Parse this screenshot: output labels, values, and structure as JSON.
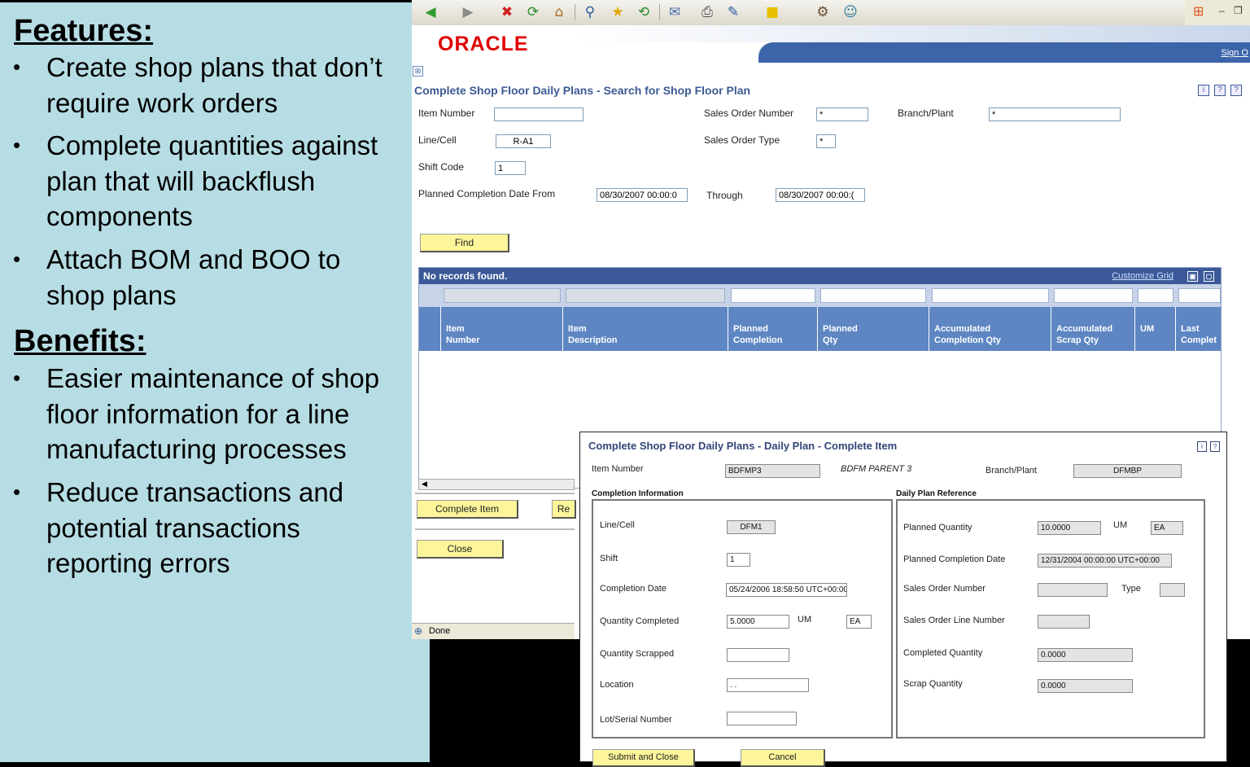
{
  "slide": {
    "features_heading": "Features:",
    "features": [
      {
        "lines": [
          "Create shop plans that don’t",
          "require work orders"
        ]
      },
      {
        "lines": [
          "Complete quantities against",
          "plan that will backflush",
          "components"
        ]
      },
      {
        "lines": [
          "Attach BOM and BOO to",
          "shop plans"
        ]
      }
    ],
    "benefits_heading": "Benefits:",
    "benefits": [
      {
        "lines": [
          "Easier maintenance of shop",
          "floor information for a line",
          "manufacturing processes"
        ]
      },
      {
        "lines": [
          "Reduce transactions and",
          "potential transactions",
          "reporting errors"
        ]
      }
    ],
    "bullet_glyph": "•"
  },
  "browser": {
    "brand": "ORACLE",
    "sign_out": "Sign O",
    "status": "Done",
    "colors": {
      "brand_red": "#e00000",
      "band_blue": "#3c64a8",
      "button_yellow": "#fcf59a"
    }
  },
  "search_form": {
    "title": "Complete Shop Floor Daily Plans - Search for Shop Floor Plan",
    "item_number_label": "Item Number",
    "item_number_value": "",
    "sales_order_number_label": "Sales Order Number",
    "sales_order_number_value": "*",
    "branch_plant_label": "Branch/Plant",
    "branch_plant_value": "*",
    "line_cell_label": "Line/Cell",
    "line_cell_value": "R-A1",
    "sales_order_type_label": "Sales Order Type",
    "sales_order_type_value": "*",
    "shift_code_label": "Shift Code",
    "shift_code_value": "1",
    "planned_from_label": "Planned Completion Date From",
    "planned_from_value": "08/30/2007 00:00:0",
    "through_label": "Through",
    "through_value": "08/30/2007 00:00:(",
    "find_button": "Find"
  },
  "grid": {
    "message": "No records found.",
    "customize": "Customize Grid",
    "columns": [
      {
        "line1": "Item",
        "line2": "Number"
      },
      {
        "line1": "Item",
        "line2": "Description"
      },
      {
        "line1": "Planned",
        "line2": "Completion"
      },
      {
        "line1": "Planned",
        "line2": "Qty"
      },
      {
        "line1": "Accumulated",
        "line2": "Completion Qty"
      },
      {
        "line1": "Accumulated",
        "line2": "Scrap Qty"
      },
      {
        "line1": "",
        "line2": "UM"
      },
      {
        "line1": "Last",
        "line2": "Complet"
      }
    ],
    "complete_item_button": "Complete Item",
    "re_button": "Re",
    "close_button": "Close"
  },
  "popup": {
    "title": "Complete Shop Floor Daily Plans - Daily Plan - Complete Item",
    "item_number_label": "Item Number",
    "item_number_value": "BDFMP3",
    "item_description": "BDFM PARENT 3",
    "branch_plant_label": "Branch/Plant",
    "branch_plant_value": "DFMBP",
    "completion_info_title": "Completion Information",
    "line_cell_label": "Line/Cell",
    "line_cell_value": "DFM1",
    "shift_label": "Shift",
    "shift_value": "1",
    "completion_date_label": "Completion Date",
    "completion_date_value": "05/24/2006 18:58:50  UTC+00:00",
    "qty_completed_label": "Quantity Completed",
    "qty_completed_value": "5.0000",
    "um_label": "UM",
    "um_value": "EA",
    "qty_scrapped_label": "Quantity Scrapped",
    "qty_scrapped_value": "",
    "location_label": "Location",
    "location_value": ". .",
    "lot_serial_label": "Lot/Serial Number",
    "lot_serial_value": "",
    "daily_plan_ref_title": "Daily Plan Reference",
    "planned_qty_label": "Planned Quantity",
    "planned_qty_value": "10.0000",
    "planned_um_label": "UM",
    "planned_um_value": "EA",
    "planned_date_label": "Planned Completion Date",
    "planned_date_value": "12/31/2004 00:00:00  UTC+00:00",
    "sales_order_number_label": "Sales Order Number",
    "sales_order_number_value": "",
    "type_label": "Type",
    "type_value": "",
    "sales_order_line_label": "Sales Order Line Number",
    "sales_order_line_value": "",
    "completed_qty_label": "Completed Quantity",
    "completed_qty_value": "0.0000",
    "scrap_qty_label": "Scrap Quantity",
    "scrap_qty_value": "0.0000",
    "submit_button": "Submit and Close",
    "cancel_button": "Cancel"
  }
}
